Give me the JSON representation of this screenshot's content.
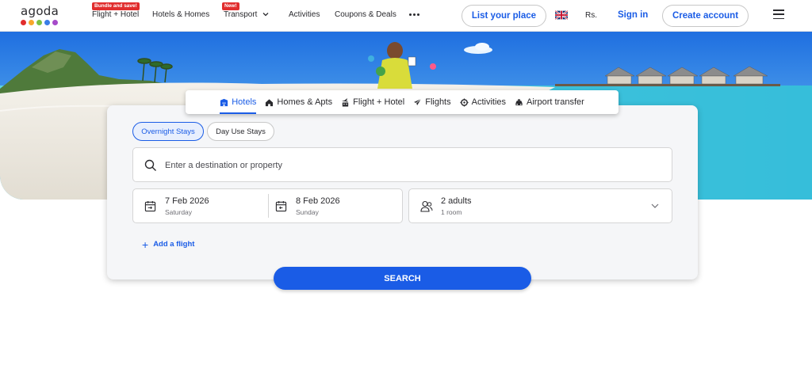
{
  "header": {
    "logo_text": "agoda",
    "logo_dot_colors": [
      "#e12d2d",
      "#f8a72b",
      "#7cc143",
      "#3a7ee6",
      "#a64ac9"
    ],
    "nav": [
      {
        "label": "Flight + Hotel",
        "badge": "Bundle and save!"
      },
      {
        "label": "Hotels & Homes",
        "badge": ""
      },
      {
        "label": "Transport",
        "badge": "New!"
      },
      {
        "label": "Activities",
        "badge": ""
      },
      {
        "label": "Coupons & Deals",
        "badge": ""
      }
    ],
    "list_place_label": "List your place",
    "currency": "Rs.",
    "sign_in_label": "Sign in",
    "create_account_label": "Create account"
  },
  "tabs": [
    {
      "label": "Hotels",
      "icon": "hotel-icon",
      "active": true
    },
    {
      "label": "Homes & Apts",
      "icon": "home-icon",
      "active": false
    },
    {
      "label": "Flight + Hotel",
      "icon": "flight-hotel-icon",
      "active": false
    },
    {
      "label": "Flights",
      "icon": "plane-icon",
      "active": false
    },
    {
      "label": "Activities",
      "icon": "activities-icon",
      "active": false
    },
    {
      "label": "Airport transfer",
      "icon": "car-icon",
      "active": false
    }
  ],
  "search": {
    "stay_types": [
      "Overnight Stays",
      "Day Use Stays"
    ],
    "destination_placeholder": "Enter a destination or property",
    "checkin": {
      "date": "7 Feb 2026",
      "day": "Saturday"
    },
    "checkout": {
      "date": "8 Feb 2026",
      "day": "Sunday"
    },
    "guests": {
      "adults": "2 adults",
      "rooms": "1 room"
    },
    "add_flight_label": "Add a flight",
    "button_label": "SEARCH"
  },
  "colors": {
    "accent": "#1a5ce6",
    "badge": "#e12d2d"
  }
}
